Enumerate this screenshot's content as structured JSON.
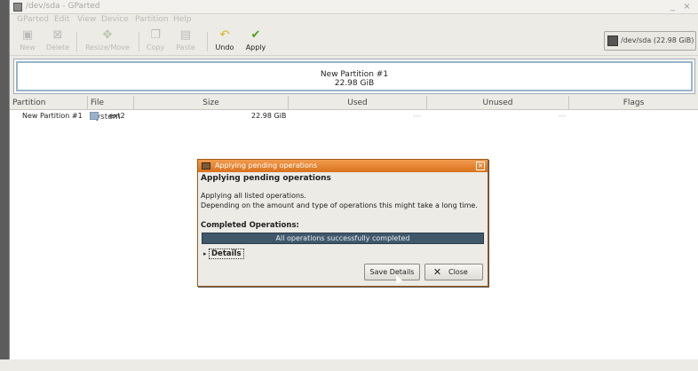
{
  "window": {
    "title": "/dev/sda - GParted"
  },
  "menu": [
    "GParted",
    "Edit",
    "View",
    "Device",
    "Partition",
    "Help"
  ],
  "toolbar": {
    "new": "New",
    "delete": "Delete",
    "resize_move": "Resize/Move",
    "copy": "Copy",
    "paste": "Paste",
    "undo": "Undo",
    "apply": "Apply"
  },
  "device_selector": {
    "label": "/dev/sda  (22.98 GiB)"
  },
  "graph": {
    "partition_name": "New Partition #1",
    "partition_size": "22.98 GiB"
  },
  "table": {
    "columns": [
      "Partition",
      "File System",
      "Size",
      "Used",
      "Unused",
      "Flags"
    ],
    "rows": [
      {
        "partition": "New Partition #1",
        "filesystem": "ext2",
        "size": "22.98 GiB",
        "used": "---",
        "unused": "---",
        "flags": ""
      }
    ]
  },
  "dialog": {
    "title": "Applying pending operations",
    "heading": "Applying pending operations",
    "line1": "Applying all listed operations.",
    "line2": "Depending on the amount and type of operations this might take a long time.",
    "completed_label": "Completed Operations:",
    "progress_text": "All operations successfully completed",
    "details_label": "Details",
    "save_details": "Save Details",
    "close": "Close",
    "close_icon": "x-icon",
    "close_icon_glyph": "✕"
  },
  "colors": {
    "dialog_title": "#e58130",
    "progress_bar": "#41586b",
    "partition_fill": "#9ab3ca"
  }
}
